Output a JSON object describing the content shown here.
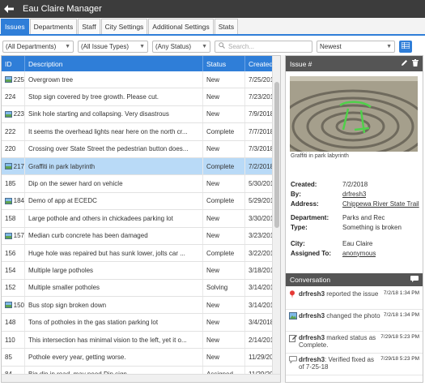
{
  "app": {
    "title": "Eau Claire Manager"
  },
  "tabs": [
    {
      "label": "Issues",
      "active": true
    },
    {
      "label": "Departments"
    },
    {
      "label": "Staff"
    },
    {
      "label": "City Settings"
    },
    {
      "label": "Additional Settings"
    },
    {
      "label": "Stats"
    }
  ],
  "filters": {
    "department": "(All Departments)",
    "issue_type": "(All Issue Types)",
    "status": "(Any Status)",
    "search_placeholder": "Search...",
    "sort": "Newest"
  },
  "columns": {
    "id": "ID",
    "description": "Description",
    "status": "Status",
    "created": "Created"
  },
  "rows": [
    {
      "id": "225",
      "photo": true,
      "desc": "Overgrown tree",
      "status": "New",
      "created": "7/25/201"
    },
    {
      "id": "224",
      "photo": false,
      "desc": "Stop sign covered by tree growth. Please cut.",
      "status": "New",
      "created": "7/23/201"
    },
    {
      "id": "223",
      "photo": true,
      "desc": "Sink hole starting and collapsing. Very disastrous",
      "status": "New",
      "created": "7/9/2018"
    },
    {
      "id": "222",
      "photo": false,
      "desc": "It seems the overhead lights near here on the north cr...",
      "status": "Complete",
      "created": "7/7/2018"
    },
    {
      "id": "220",
      "photo": false,
      "desc": "Crossing over State Street the pedestrian button does...",
      "status": "New",
      "created": "7/3/2018"
    },
    {
      "id": "217",
      "photo": true,
      "desc": "Graffiti in park labyrinth",
      "status": "Complete",
      "created": "7/2/2018",
      "selected": true
    },
    {
      "id": "185",
      "photo": false,
      "desc": "Dip on the sewer hard on vehicle",
      "status": "New",
      "created": "5/30/201"
    },
    {
      "id": "184",
      "photo": true,
      "desc": "Demo of app at ECEDC",
      "status": "Complete",
      "created": "5/29/201"
    },
    {
      "id": "158",
      "photo": false,
      "desc": "Large pothole and others in chickadees parking lot",
      "status": "New",
      "created": "3/30/201"
    },
    {
      "id": "157",
      "photo": true,
      "desc": "Median curb concrete has been damaged",
      "status": "New",
      "created": "3/23/201"
    },
    {
      "id": "156",
      "photo": false,
      "desc": "Huge hole was repaired but has sunk lower, jolts car ...",
      "status": "Complete",
      "created": "3/22/201"
    },
    {
      "id": "154",
      "photo": false,
      "desc": "Multiple large potholes",
      "status": "New",
      "created": "3/18/201"
    },
    {
      "id": "152",
      "photo": false,
      "desc": "Multiple smaller potholes",
      "status": "Solving",
      "created": "3/14/201"
    },
    {
      "id": "150",
      "photo": true,
      "desc": "Bus stop sign broken down",
      "status": "New",
      "created": "3/14/201"
    },
    {
      "id": "148",
      "photo": false,
      "desc": "Tons of potholes in the gas station parking lot",
      "status": "New",
      "created": "3/4/2018"
    },
    {
      "id": "110",
      "photo": false,
      "desc": "This intersection has minimal vision to the left, yet it o...",
      "status": "New",
      "created": "2/14/201"
    },
    {
      "id": "85",
      "photo": false,
      "desc": "Pothole every year, getting worse.",
      "status": "New",
      "created": "11/29/20"
    },
    {
      "id": "84",
      "photo": false,
      "desc": "Big dip in road, may need Dip sign.",
      "status": "Assigned",
      "created": "11/29/20"
    }
  ],
  "detail": {
    "header": "Issue #",
    "caption": "Graffiti in park labyrinth",
    "props": [
      {
        "k": "Created:",
        "v": "7/2/2018",
        "link": false
      },
      {
        "k": "By:",
        "v": "drfresh3",
        "link": true
      },
      {
        "k": "Address:",
        "v": "Chippewa River State Trail",
        "link": true
      },
      {
        "k": "Department:",
        "v": "Parks and Rec",
        "link": false
      },
      {
        "k": "Type:",
        "v": "Something is broken",
        "link": false
      },
      {
        "k": "City:",
        "v": "Eau Claire",
        "link": false
      },
      {
        "k": "Assigned To:",
        "v": "anonymous",
        "link": true
      }
    ]
  },
  "conversation": {
    "title": "Conversation",
    "messages": [
      {
        "icon": "pin-icon",
        "user": "drfresh3",
        "text": " reported the issue",
        "time": "7/2/18 1:34 PM"
      },
      {
        "icon": "photo-icon",
        "user": "drfresh3",
        "text": " changed the photo",
        "time": "7/2/18 1:34 PM"
      },
      {
        "icon": "edit-icon",
        "user": "drfresh3",
        "text": " marked status as Complete.",
        "time": "7/29/18 5:23 PM"
      },
      {
        "icon": "comment-icon",
        "user": "drfresh3",
        "text": ": Verified fixed as of 7-25-18",
        "time": "7/29/18 5:23 PM"
      }
    ]
  }
}
